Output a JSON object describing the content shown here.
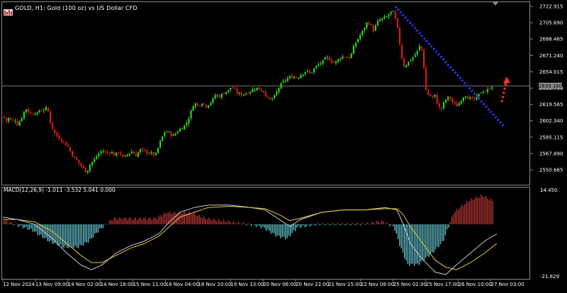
{
  "symbol_header": {
    "title": "GOLD, H1:  Gold (100 oz) vs US Dollar CFD"
  },
  "current_price": "2639.160",
  "price_axis": {
    "ticks": [
      "2722.915",
      "2705.690",
      "2688.465",
      "2671.240",
      "2654.015",
      "2636.790",
      "2619.565",
      "2602.340",
      "2585.115",
      "2567.890",
      "2550.665"
    ]
  },
  "macd": {
    "header": "MACD(12,26,9) -1.011 -3.532 5.041 0.000",
    "axis_top": "14.450",
    "axis_bottom": "-21.629"
  },
  "time_axis": {
    "labels": [
      "12 Nov 2024",
      "13 Nov 09:00",
      "14 Nov 02:00",
      "14 Nov 18:00",
      "15 Nov 11:00",
      "18 Nov 04:00",
      "18 Nov 20:00",
      "19 Nov 13:00",
      "20 Nov 06:00",
      "20 Nov 22:00",
      "21 Nov 15:00",
      "22 Nov 08:00",
      "25 Nov 01:00",
      "25 Nov 17:00",
      "26 Nov 10:00",
      "27 Nov 03:00"
    ]
  },
  "colors": {
    "background": "#000000",
    "bull_candle": "#33d11a",
    "bear_candle": "#d81a1a",
    "trendline": "#2b35ff",
    "projection_arrow": "#ff2d2d",
    "hist_positive": "#b23333",
    "hist_negative": "#5fb8c4",
    "macd_line": "#c6c9d6",
    "signal_line": "#e7c838",
    "axis_text": "#ffffff",
    "grid": "#3a3a3a"
  },
  "chart_data": {
    "type": "candlestick",
    "price_path": [
      [
        0,
        2603
      ],
      [
        5,
        2607
      ],
      [
        9,
        2602
      ],
      [
        13,
        2606
      ],
      [
        17,
        2601
      ],
      [
        21,
        2604
      ],
      [
        25,
        2598
      ],
      [
        30,
        2605
      ],
      [
        33,
        2610
      ],
      [
        36,
        2616
      ],
      [
        40,
        2612
      ],
      [
        44,
        2609
      ],
      [
        48,
        2612
      ],
      [
        52,
        2609
      ],
      [
        56,
        2614
      ],
      [
        60,
        2613
      ],
      [
        64,
        2616
      ],
      [
        68,
        2612
      ],
      [
        72,
        2598
      ],
      [
        78,
        2588
      ],
      [
        84,
        2584
      ],
      [
        90,
        2580
      ],
      [
        96,
        2575
      ],
      [
        102,
        2566
      ],
      [
        108,
        2561
      ],
      [
        112,
        2557
      ],
      [
        116,
        2554
      ],
      [
        120,
        2549
      ],
      [
        124,
        2551
      ],
      [
        128,
        2558
      ],
      [
        132,
        2560
      ],
      [
        138,
        2567
      ],
      [
        144,
        2571
      ],
      [
        150,
        2568
      ],
      [
        156,
        2570
      ],
      [
        162,
        2566
      ],
      [
        168,
        2570
      ],
      [
        174,
        2563
      ],
      [
        180,
        2567
      ],
      [
        186,
        2570
      ],
      [
        192,
        2566
      ],
      [
        198,
        2572
      ],
      [
        204,
        2570
      ],
      [
        210,
        2569
      ],
      [
        216,
        2567
      ],
      [
        220,
        2567
      ],
      [
        224,
        2576
      ],
      [
        228,
        2584
      ],
      [
        232,
        2590
      ],
      [
        236,
        2591
      ],
      [
        240,
        2589
      ],
      [
        244,
        2586
      ],
      [
        250,
        2591
      ],
      [
        256,
        2595
      ],
      [
        262,
        2598
      ],
      [
        266,
        2605
      ],
      [
        270,
        2613
      ],
      [
        274,
        2622
      ],
      [
        278,
        2618
      ],
      [
        282,
        2620
      ],
      [
        286,
        2622
      ],
      [
        290,
        2617
      ],
      [
        296,
        2621
      ],
      [
        300,
        2624
      ],
      [
        304,
        2630
      ],
      [
        310,
        2628
      ],
      [
        316,
        2632
      ],
      [
        322,
        2634
      ],
      [
        326,
        2638
      ],
      [
        330,
        2636
      ],
      [
        334,
        2632
      ],
      [
        340,
        2630
      ],
      [
        346,
        2631
      ],
      [
        352,
        2633
      ],
      [
        358,
        2636
      ],
      [
        364,
        2637
      ],
      [
        368,
        2634
      ],
      [
        372,
        2634
      ],
      [
        376,
        2628
      ],
      [
        380,
        2624
      ],
      [
        386,
        2626
      ],
      [
        390,
        2632
      ],
      [
        394,
        2638
      ],
      [
        398,
        2642
      ],
      [
        402,
        2645
      ],
      [
        408,
        2648
      ],
      [
        414,
        2649
      ],
      [
        420,
        2648
      ],
      [
        426,
        2652
      ],
      [
        432,
        2655
      ],
      [
        438,
        2652
      ],
      [
        444,
        2658
      ],
      [
        450,
        2662
      ],
      [
        456,
        2665
      ],
      [
        460,
        2669
      ],
      [
        464,
        2668
      ],
      [
        468,
        2665
      ],
      [
        472,
        2663
      ],
      [
        476,
        2666
      ],
      [
        482,
        2670
      ],
      [
        488,
        2670
      ],
      [
        492,
        2668
      ],
      [
        496,
        2673
      ],
      [
        500,
        2682
      ],
      [
        506,
        2690
      ],
      [
        512,
        2697
      ],
      [
        518,
        2706
      ],
      [
        522,
        2705
      ],
      [
        526,
        2697
      ],
      [
        530,
        2702
      ],
      [
        534,
        2708
      ],
      [
        540,
        2710
      ],
      [
        546,
        2712
      ],
      [
        550,
        2716
      ],
      [
        554,
        2718
      ],
      [
        558,
        2709
      ],
      [
        562,
        2695
      ],
      [
        566,
        2672
      ],
      [
        570,
        2660
      ],
      [
        574,
        2662
      ],
      [
        578,
        2666
      ],
      [
        584,
        2670
      ],
      [
        590,
        2677
      ],
      [
        594,
        2684
      ],
      [
        598,
        2660
      ],
      [
        600,
        2637
      ],
      [
        604,
        2630
      ],
      [
        610,
        2627
      ],
      [
        614,
        2629
      ],
      [
        618,
        2618
      ],
      [
        622,
        2614
      ],
      [
        628,
        2624
      ],
      [
        634,
        2628
      ],
      [
        638,
        2622
      ],
      [
        644,
        2618
      ],
      [
        648,
        2621
      ],
      [
        652,
        2626
      ],
      [
        656,
        2630
      ],
      [
        662,
        2626
      ],
      [
        668,
        2624
      ],
      [
        674,
        2628
      ],
      [
        680,
        2634
      ],
      [
        686,
        2633
      ],
      [
        692,
        2638
      ],
      [
        697,
        2640
      ]
    ],
    "trendline": {
      "from": [
        "25 Nov 01:00",
        2722.9
      ],
      "to": [
        "27 Nov 03:00",
        2599
      ]
    },
    "projection_arrow": {
      "from": 2622,
      "to": 2649,
      "direction": "up"
    },
    "macd_line_path": [
      [
        0,
        3
      ],
      [
        20,
        2
      ],
      [
        45,
        0
      ],
      [
        70,
        -6
      ],
      [
        90,
        -12
      ],
      [
        110,
        -17
      ],
      [
        125,
        -19
      ],
      [
        140,
        -17
      ],
      [
        160,
        -12
      ],
      [
        180,
        -9
      ],
      [
        200,
        -7
      ],
      [
        220,
        -4
      ],
      [
        235,
        1
      ],
      [
        250,
        5
      ],
      [
        270,
        7
      ],
      [
        290,
        8
      ],
      [
        320,
        8
      ],
      [
        350,
        7
      ],
      [
        370,
        6
      ],
      [
        390,
        2
      ],
      [
        405,
        -1
      ],
      [
        420,
        2
      ],
      [
        450,
        5
      ],
      [
        480,
        6
      ],
      [
        510,
        6
      ],
      [
        540,
        7
      ],
      [
        556,
        6
      ],
      [
        565,
        0
      ],
      [
        575,
        -8
      ],
      [
        590,
        -14
      ],
      [
        600,
        -17
      ],
      [
        610,
        -20
      ],
      [
        625,
        -21
      ],
      [
        640,
        -17
      ],
      [
        660,
        -12
      ],
      [
        680,
        -7
      ],
      [
        697,
        -4
      ]
    ],
    "signal_line_path": [
      [
        0,
        2
      ],
      [
        20,
        2
      ],
      [
        45,
        1
      ],
      [
        70,
        -3
      ],
      [
        90,
        -8
      ],
      [
        110,
        -13
      ],
      [
        125,
        -16
      ],
      [
        140,
        -16
      ],
      [
        160,
        -13
      ],
      [
        180,
        -10
      ],
      [
        200,
        -8
      ],
      [
        220,
        -5
      ],
      [
        235,
        -1
      ],
      [
        250,
        3
      ],
      [
        270,
        5
      ],
      [
        290,
        7
      ],
      [
        320,
        7.5
      ],
      [
        350,
        7
      ],
      [
        370,
        6.5
      ],
      [
        390,
        4
      ],
      [
        405,
        1.5
      ],
      [
        420,
        2.5
      ],
      [
        450,
        5
      ],
      [
        480,
        6
      ],
      [
        510,
        6
      ],
      [
        540,
        6.5
      ],
      [
        556,
        6.5
      ],
      [
        565,
        4
      ],
      [
        575,
        -1
      ],
      [
        590,
        -7
      ],
      [
        600,
        -11
      ],
      [
        610,
        -15
      ],
      [
        625,
        -18
      ],
      [
        640,
        -19
      ],
      [
        660,
        -16
      ],
      [
        680,
        -12
      ],
      [
        697,
        -8
      ]
    ]
  }
}
